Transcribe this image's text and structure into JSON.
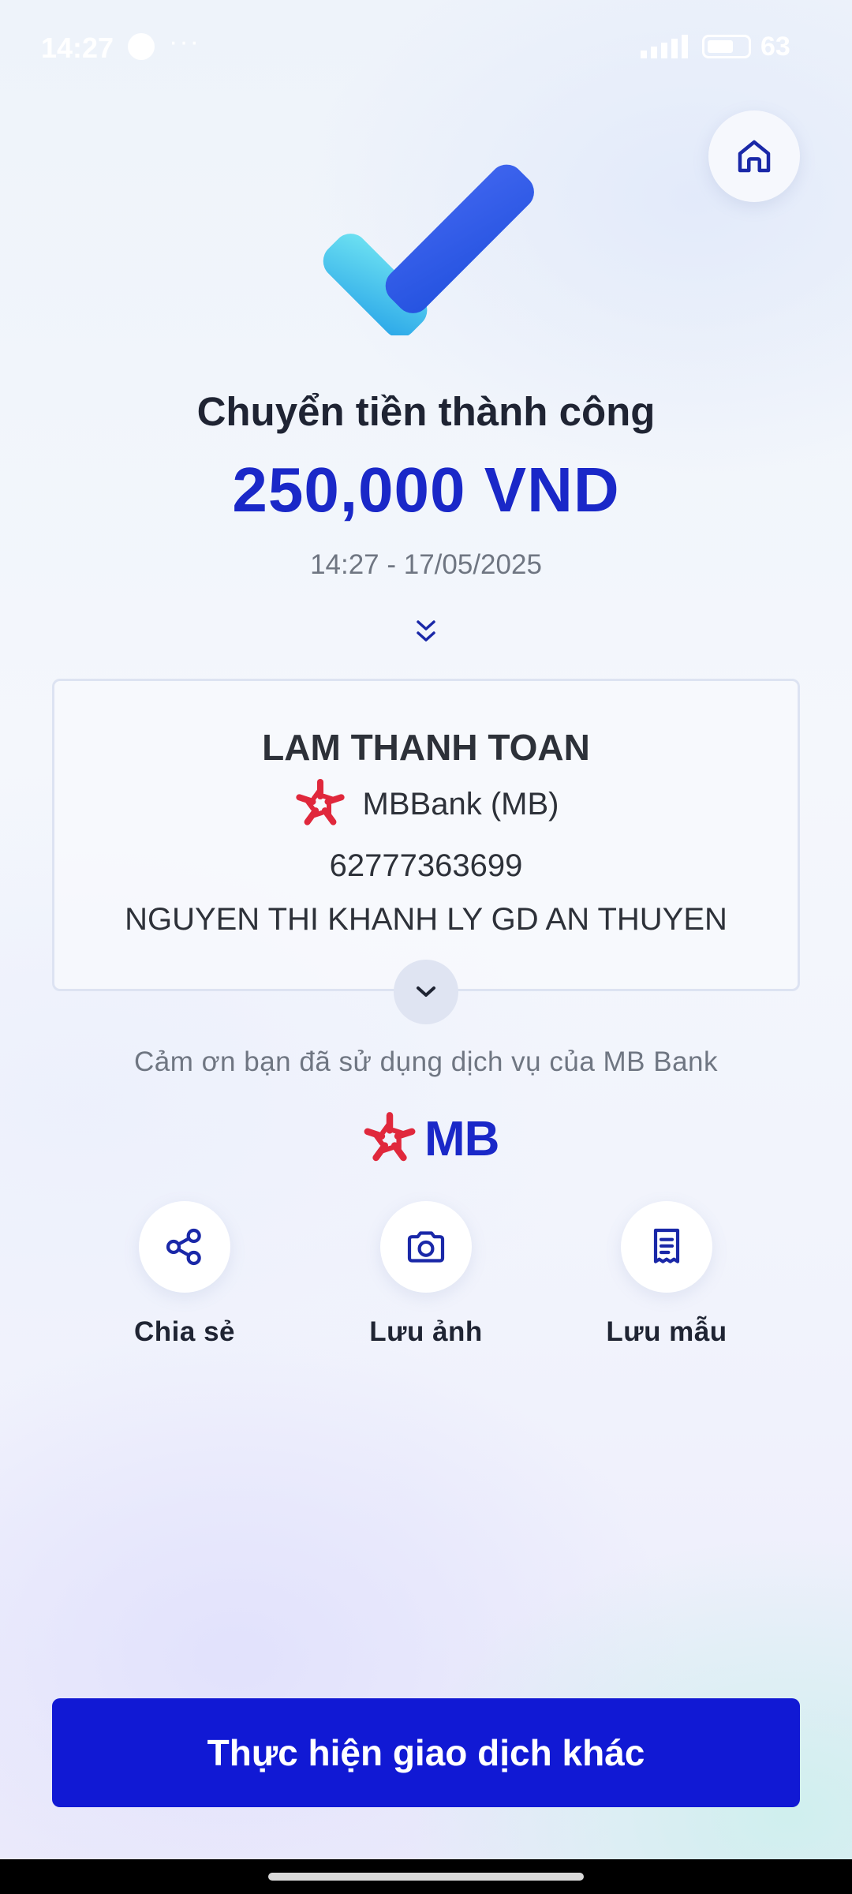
{
  "status_bar": {
    "time": "14:27",
    "dots": "···",
    "battery": "63"
  },
  "icons": {
    "home": "home-icon",
    "check": "check-mark-icon",
    "chevrons": "double-chevron-down-icon",
    "share": "share-icon",
    "camera": "camera-icon",
    "template": "receipt-icon"
  },
  "result": {
    "title": "Chuyển tiền thành công",
    "amount": "250,000 VND",
    "datetime": "14:27 - 17/05/2025"
  },
  "recipient": {
    "name": "LAM THANH TOAN",
    "bank": "MBBank (MB)",
    "account_number": "62777363699",
    "account_owner": "NGUYEN THI KHANH LY GD AN THUYEN"
  },
  "thanks": "Cảm ơn bạn đã sử dụng dịch vụ của MB Bank",
  "brand": {
    "logo_text": "MB",
    "primary_color": "#1a28c8",
    "accent_red": "#e0283c"
  },
  "actions": [
    {
      "label": "Chia sẻ"
    },
    {
      "label": "Lưu ảnh"
    },
    {
      "label": "Lưu mẫu"
    }
  ],
  "primary_button": "Thực hiện giao dịch khác"
}
